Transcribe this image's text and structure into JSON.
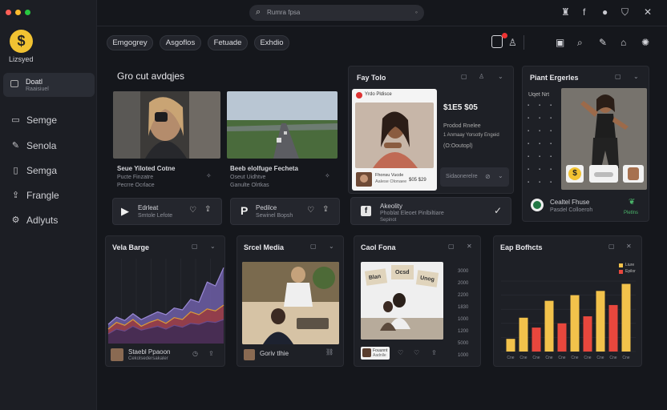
{
  "window": {
    "dots": [
      "#ff5f57",
      "#febc2e",
      "#28c840"
    ]
  },
  "sidebar": {
    "logo_glyph": "$",
    "logo_label": "Lizsyed",
    "active_item": {
      "label": "Doatl",
      "sub": "Raaisiuel"
    },
    "items": [
      {
        "label": "Semge",
        "icon": "monitor-icon"
      },
      {
        "label": "Senola",
        "icon": "pen-icon"
      },
      {
        "label": "Semga",
        "icon": "book-icon"
      },
      {
        "label": "Frangle",
        "icon": "share-icon"
      },
      {
        "label": "Adlyuts",
        "icon": "gear-icon"
      }
    ]
  },
  "search": {
    "placeholder": "Rumra fpsa"
  },
  "tabs": [
    "Emgogrey",
    "Asgoflos",
    "Fetuade",
    "Exhdio"
  ],
  "content": {
    "heading": "Gro cut avdqjes",
    "video1": {
      "title": "Seue Yiloted Cotne",
      "sub1": "Pucte Finzatre",
      "sub2": "Pecrre Ocrlace"
    },
    "video2": {
      "title": "Beeb elolfuge Fecheta",
      "sub1": "Oseut Uidhtve",
      "sub2": "Ganulte Olrtkas"
    },
    "controls1": {
      "label": "Edrleat",
      "sub": "Smtole Lefote"
    },
    "controls2": {
      "label": "Pedilce",
      "sub": "Sewinel Bopsh"
    },
    "play_glyph": "▶",
    "p_glyph": "P"
  },
  "fay_tolo": {
    "title": "Fay Tolo",
    "post_name": "Yrdo Pldisce",
    "price": "$1E5 $05",
    "line1": "Prodod Rnelee",
    "line2": "1 Anmaay Yorsotly Engeid",
    "line3": "(O:Ooutopl)",
    "thumb_name": "Fhonsu Vucde",
    "thumb_sub": "Aalese Olonaee",
    "thumb_price": "$05 $29",
    "footer_label": "Sidaonerelre",
    "activity_title": "Akeolity",
    "activity_sub": "Phoblat Eleoet Pinlbiltiare",
    "activity_sub2": "Sepinot"
  },
  "plant": {
    "title": "Piant Ergerles",
    "legend_head": "Uqet Nrt",
    "footer_name": "Cealtel Fhuse",
    "footer_sub": "Pasdel Colloeroh",
    "footer_tag": "Pletlns"
  },
  "vela": {
    "title": "Vela Barge",
    "footer_name": "Staebl Ppaoon",
    "footer_sub": "Cekolsedersakaler"
  },
  "social": {
    "title": "Srcel Media",
    "footer_name": "Goriv tlhie"
  },
  "coal": {
    "title": "Caol Fona",
    "axis": [
      "3000",
      "2000",
      "2200",
      "1830",
      "1000",
      "1200",
      "5000",
      "1000"
    ],
    "signs": [
      "Blan",
      "Ocsd",
      "Unog"
    ],
    "footer_name": "Fouunnt",
    "footer_sub": "Aadnlle"
  },
  "trendy": {
    "title": "Eap Bofhcts",
    "legend": [
      "Liure",
      "Epilor"
    ]
  },
  "chart_data": [
    {
      "type": "area",
      "title": "Vela Barge",
      "x": [
        0,
        1,
        2,
        3,
        4,
        5,
        6,
        7,
        8,
        9,
        10,
        11,
        12,
        13,
        14
      ],
      "series": [
        {
          "values": [
            40,
            55,
            48,
            62,
            50,
            58,
            66,
            60,
            74,
            70,
            92,
            86,
            128,
            120,
            158
          ],
          "color": "#6e5fa8"
        },
        {
          "values": [
            30,
            44,
            38,
            50,
            36,
            44,
            50,
            42,
            54,
            50,
            66,
            60,
            72,
            68,
            80
          ],
          "color": "#9b3b3e"
        },
        {
          "values": [
            20,
            30,
            26,
            36,
            28,
            32,
            36,
            30,
            38,
            34,
            42,
            40,
            46,
            44,
            50
          ],
          "color": "#3b2a55"
        }
      ],
      "ylim": [
        0,
        170
      ]
    },
    {
      "type": "bar",
      "title": "Eap Bofhcts",
      "categories": [
        "Cne",
        "Cne",
        "Cne",
        "Cne",
        "Cne",
        "Cne",
        "Cne",
        "Cne",
        "Cne",
        "Cne"
      ],
      "values": [
        18,
        48,
        34,
        72,
        40,
        80,
        50,
        86,
        66,
        96
      ],
      "colors": [
        "#f2c24b",
        "#f2c24b",
        "#e8473d",
        "#f2c24b",
        "#e8473d",
        "#f2c24b",
        "#e8473d",
        "#f2c24b",
        "#e8473d",
        "#f2c24b"
      ],
      "ylim": [
        0,
        100
      ]
    }
  ]
}
